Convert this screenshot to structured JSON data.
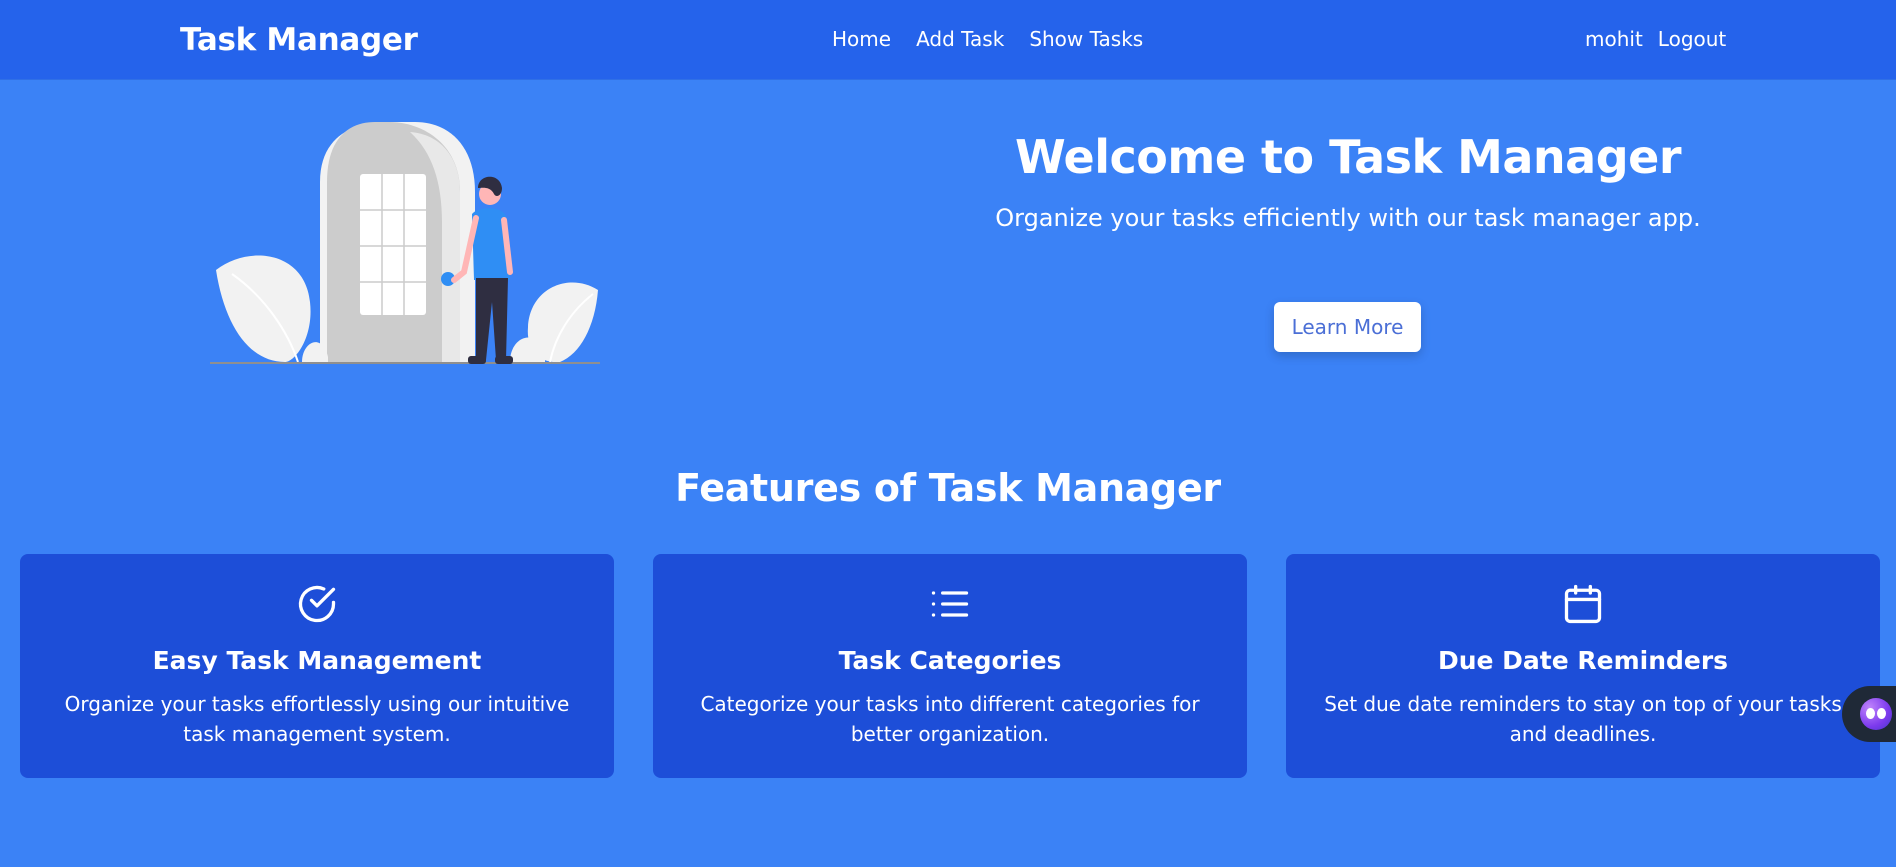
{
  "navbar": {
    "brand": "Task Manager",
    "links": [
      "Home",
      "Add Task",
      "Show Tasks"
    ],
    "username": "mohit",
    "logout": "Logout"
  },
  "hero": {
    "title": "Welcome to Task Manager",
    "subtitle": "Organize your tasks efficiently with our task manager app.",
    "button": "Learn More"
  },
  "features": {
    "title": "Features of Task Manager",
    "cards": [
      {
        "icon": "check-circle-icon",
        "title": "Easy Task Management",
        "description": "Organize your tasks effortlessly using our intuitive task management system."
      },
      {
        "icon": "list-icon",
        "title": "Task Categories",
        "description": "Categorize your tasks into different categories for better organization."
      },
      {
        "icon": "calendar-icon",
        "title": "Due Date Reminders",
        "description": "Set due date reminders to stay on top of your tasks and deadlines."
      }
    ]
  },
  "colors": {
    "background": "#3b82f6",
    "navbar": "#2563eb",
    "card": "#1d4ed8",
    "button_text": "#4b6fd6"
  }
}
